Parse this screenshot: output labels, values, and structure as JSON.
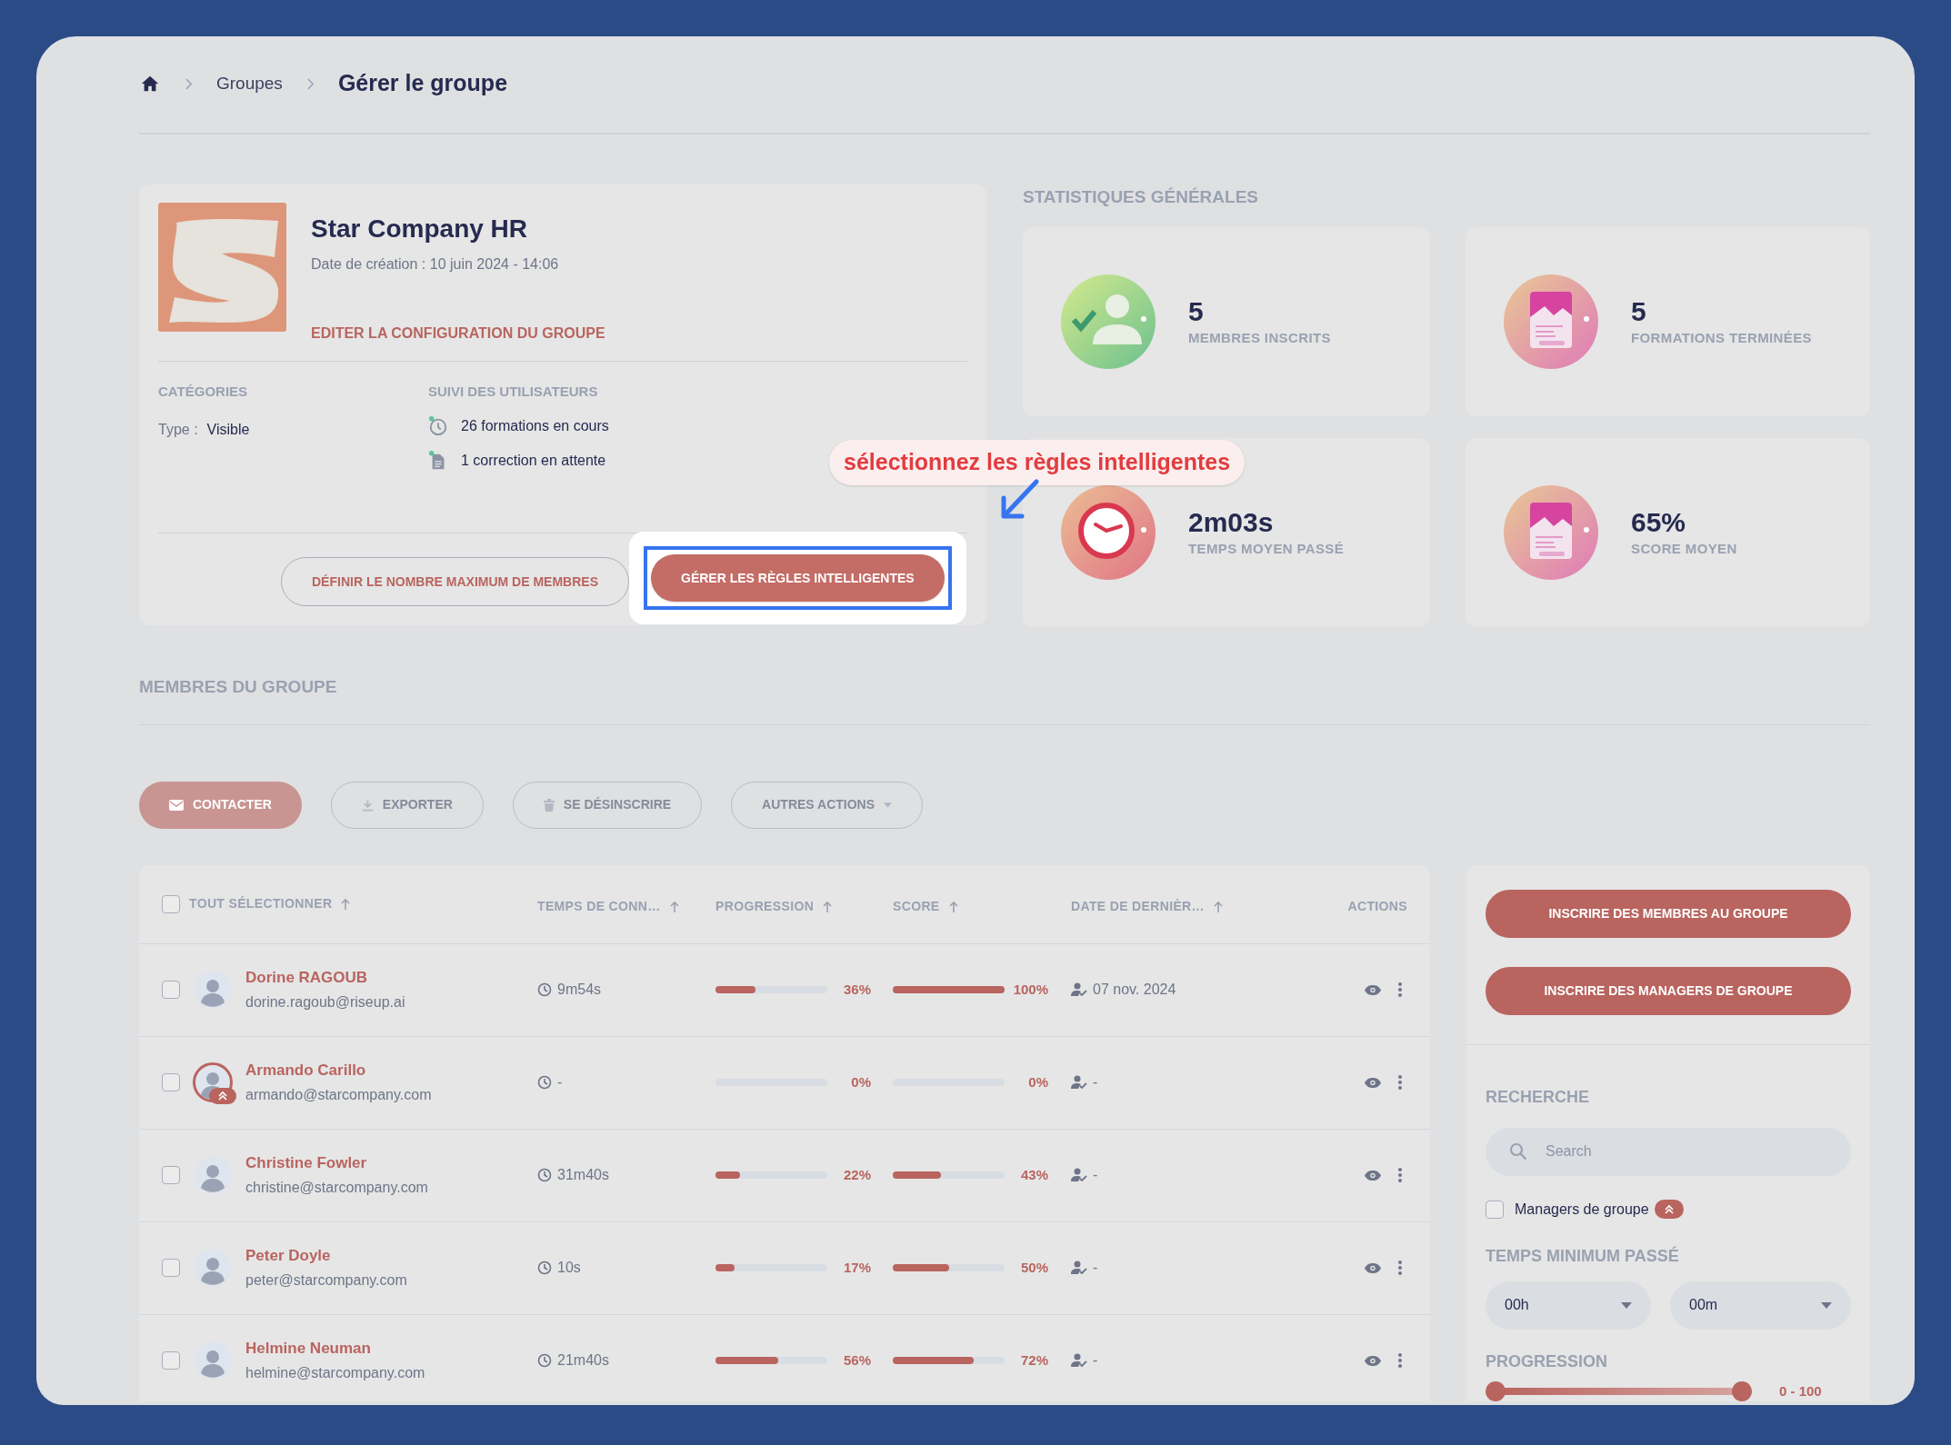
{
  "breadcrumb": [
    "Groupes",
    "Gérer le groupe"
  ],
  "group": {
    "name": "Star Company HR",
    "created": "Date de création : 10 juin 2024 - 14:06",
    "edit_link": "EDITER LA CONFIGURATION DU GROUPE",
    "categories": {
      "heading": "CATÉGORIES",
      "type_label": "Type :",
      "type_value": "Visible"
    },
    "tracking": {
      "heading": "SUIVI DES UTILISATEURS",
      "items": [
        {
          "kind": "clock",
          "text": "26 formations en cours"
        },
        {
          "kind": "document",
          "text": "1 correction en attente"
        }
      ]
    },
    "buttons": [
      {
        "kind": "outline",
        "label": "DÉFINIR LE NOMBRE MAXIMUM DE MEMBRES",
        "highlighted": false
      },
      {
        "kind": "filled",
        "label": "GÉRER LES RÈGLES INTELLIGENTES",
        "highlighted": true
      }
    ]
  },
  "annotation": {
    "text": "sélectionnez les règles intelligentes"
  },
  "stats": {
    "title": "STATISTIQUES GÉNÉRALES",
    "cards": [
      {
        "kind": "members",
        "value": "5",
        "label": "MEMBRES INSCRITS"
      },
      {
        "kind": "document",
        "value": "5",
        "label": "FORMATIONS TERMINÉES"
      },
      {
        "kind": "clock",
        "value": "2m03s",
        "label": "TEMPS MOYEN PASSÉ"
      },
      {
        "kind": "document",
        "value": "65%",
        "label": "SCORE MOYEN"
      }
    ]
  },
  "members": {
    "title": "MEMBRES DU GROUPE",
    "toolbar": [
      {
        "kind": "contact",
        "label": "CONTACTER"
      },
      {
        "kind": "export",
        "label": "EXPORTER"
      },
      {
        "kind": "unsubscribe",
        "label": "SE DÉSINSCRIRE"
      },
      {
        "kind": "more",
        "label": "AUTRES ACTIONS"
      }
    ],
    "table": {
      "select_all": {
        "label": "TOUT SÉLECTIONNER",
        "checked": false,
        "sortable": true
      },
      "columns": [
        {
          "label": "TEMPS DE CONN…",
          "sortable": true
        },
        {
          "label": "PROGRESSION",
          "sortable": true
        },
        {
          "label": "SCORE",
          "sortable": true
        },
        {
          "label": "DATE DE DERNIÈR…",
          "sortable": true
        },
        {
          "label": "ACTIONS",
          "sortable": false
        }
      ],
      "rows": [
        {
          "checked": false,
          "manager": false,
          "name": "Dorine RAGOUB",
          "email": "dorine.ragoub@riseup.ai",
          "time": "9m54s",
          "progress": {
            "level": 0.36,
            "text": "36%"
          },
          "score": {
            "level": 1,
            "text": "100%"
          },
          "last_date": "07 nov. 2024"
        },
        {
          "checked": false,
          "manager": true,
          "name": "Armando Carillo",
          "email": "armando@starcompany.com",
          "time": "-",
          "progress": {
            "level": 0,
            "text": "0%"
          },
          "score": {
            "level": 0,
            "text": "0%"
          },
          "last_date": "-"
        },
        {
          "checked": false,
          "manager": false,
          "name": "Christine Fowler",
          "email": "christine@starcompany.com",
          "time": "31m40s",
          "progress": {
            "level": 0.22,
            "text": "22%"
          },
          "score": {
            "level": 0.43,
            "text": "43%"
          },
          "last_date": "-"
        },
        {
          "checked": false,
          "manager": false,
          "name": "Peter Doyle",
          "email": "peter@starcompany.com",
          "time": "10s",
          "progress": {
            "level": 0.17,
            "text": "17%"
          },
          "score": {
            "level": 0.5,
            "text": "50%"
          },
          "last_date": "-"
        },
        {
          "checked": false,
          "manager": false,
          "name": "Helmine Neuman",
          "email": "helmine@starcompany.com",
          "time": "21m40s",
          "progress": {
            "level": 0.56,
            "text": "56%"
          },
          "score": {
            "level": 0.72,
            "text": "72%"
          },
          "last_date": "-"
        }
      ]
    }
  },
  "sidebar": {
    "buttons": [
      "INSCRIRE DES MEMBRES AU GROUPE",
      "INSCRIRE DES MANAGERS DE GROUPE"
    ],
    "search": {
      "heading": "RECHERCHE",
      "placeholder": "Search"
    },
    "managers_filter": {
      "label": "Managers de groupe",
      "checked": false
    },
    "min_time": {
      "heading": "TEMPS MINIMUM PASSÉ",
      "hours": "00h",
      "minutes": "00m"
    },
    "progression": {
      "heading": "PROGRESSION",
      "thumbs": [
        {
          "level": 0
        },
        {
          "level": 1
        }
      ],
      "reading": "0 - 100"
    }
  }
}
